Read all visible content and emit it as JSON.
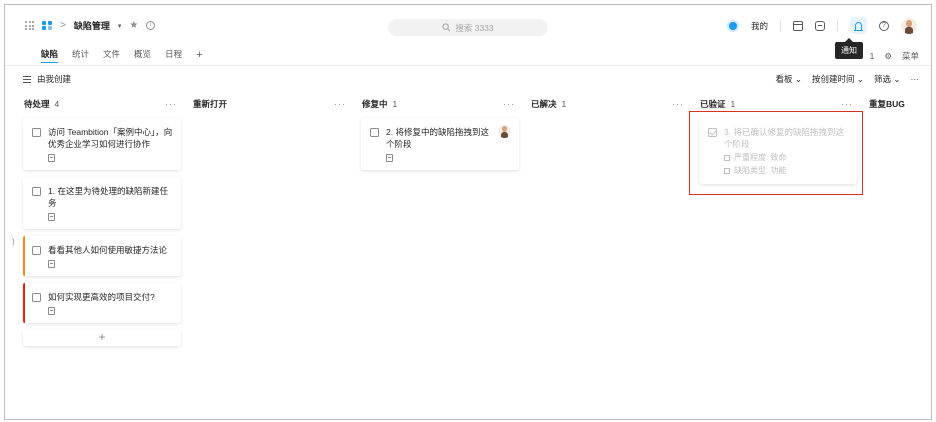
{
  "header": {
    "breadcrumb_sep": ">",
    "project_title": "缺陷管理",
    "caret": "▾",
    "star": "★",
    "info": "i",
    "search_placeholder": "搜索 3333",
    "my_label": "我的",
    "help": "?",
    "tooltip": "通知"
  },
  "tabs": {
    "items": [
      "缺陷",
      "统计",
      "文件",
      "概览",
      "日程"
    ],
    "plus": "+",
    "right_count": "1",
    "right_menu": "菜单",
    "right_menu_icon": "⚙"
  },
  "filterbar": {
    "label": "由我创建",
    "view": "看板 ⌄",
    "sort": "按创建时间 ⌄",
    "filter": "筛选 ⌄",
    "more": "···"
  },
  "columns": [
    {
      "name": "待处理",
      "count": "4",
      "more": "···",
      "cards": [
        {
          "title": "访问 Teambition「案例中心」，向优秀企业学习如何进行协作",
          "stripe": ""
        },
        {
          "title": "1. 在这里为待处理的缺陷新建任务",
          "stripe": ""
        },
        {
          "title": "看看其他人如何使用敏捷方法论",
          "stripe": "orange"
        },
        {
          "title": "如何实现更高效的项目交付?",
          "stripe": "red"
        }
      ],
      "add": "+"
    },
    {
      "name": "重新打开",
      "count": "",
      "more": "···",
      "cards": []
    },
    {
      "name": "修复中",
      "count": "1",
      "more": "···",
      "cards": [
        {
          "title": "2. 将修复中的缺陷拖拽到这个阶段",
          "stripe": ""
        }
      ]
    },
    {
      "name": "已解决",
      "count": "1",
      "more": "···",
      "cards": []
    },
    {
      "name": "已验证",
      "count": "1",
      "more": "···",
      "cards": [
        {
          "title": "3. 将已确认修复的缺陷拖拽到这个阶段",
          "meta1": "严重程度: 致命",
          "meta2": "缺陷类型: 功能"
        }
      ]
    },
    {
      "name": "重复BUG",
      "count": "",
      "more": "",
      "cards": []
    }
  ],
  "colors": {
    "accent": "#1b9aee",
    "stripe_orange": "#fa8c16",
    "stripe_red": "#e62412",
    "highlight": "#d93026"
  },
  "icons": [
    "apps-grid-icon",
    "project-icon",
    "star-icon",
    "info-icon",
    "search-icon",
    "calendar-icon",
    "message-icon",
    "bell-icon",
    "help-icon",
    "avatar",
    "menu-icon",
    "checkbox-icon",
    "note-icon"
  ]
}
